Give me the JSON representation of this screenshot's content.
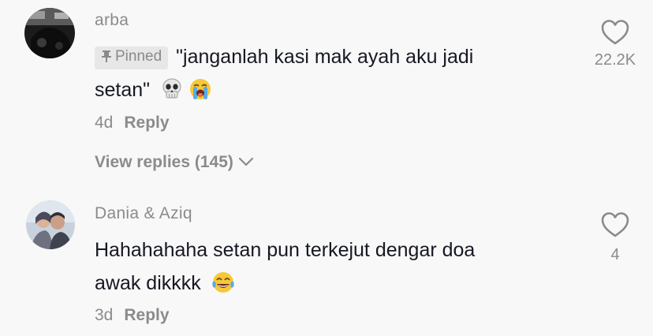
{
  "comments": [
    {
      "username": "arba",
      "pinned_label": "Pinned",
      "text_line1": "\"janganlah kasi mak ayah aku jadi",
      "text_line2": "setan\"",
      "emojis": [
        "skull-emoji",
        "loudly-crying-face-emoji"
      ],
      "age": "4d",
      "reply_label": "Reply",
      "view_replies_label": "View replies (145)",
      "like_count": "22.2K"
    },
    {
      "username": "Dania & Aziq",
      "text_line1": "Hahahahaha setan pun terkejut dengar doa",
      "text_line2": "awak dikkkk",
      "emojis": [
        "face-with-tears-of-joy-emoji"
      ],
      "age": "3d",
      "reply_label": "Reply",
      "like_count": "4"
    }
  ],
  "icons": [
    "heart-outline-icon",
    "pin-icon",
    "chevron-down-icon"
  ],
  "colors": {
    "background": "#f8f8f8",
    "primary_text": "#161823",
    "secondary_text": "#8b8b8b",
    "pinned_badge_bg": "#e7e7e7"
  }
}
